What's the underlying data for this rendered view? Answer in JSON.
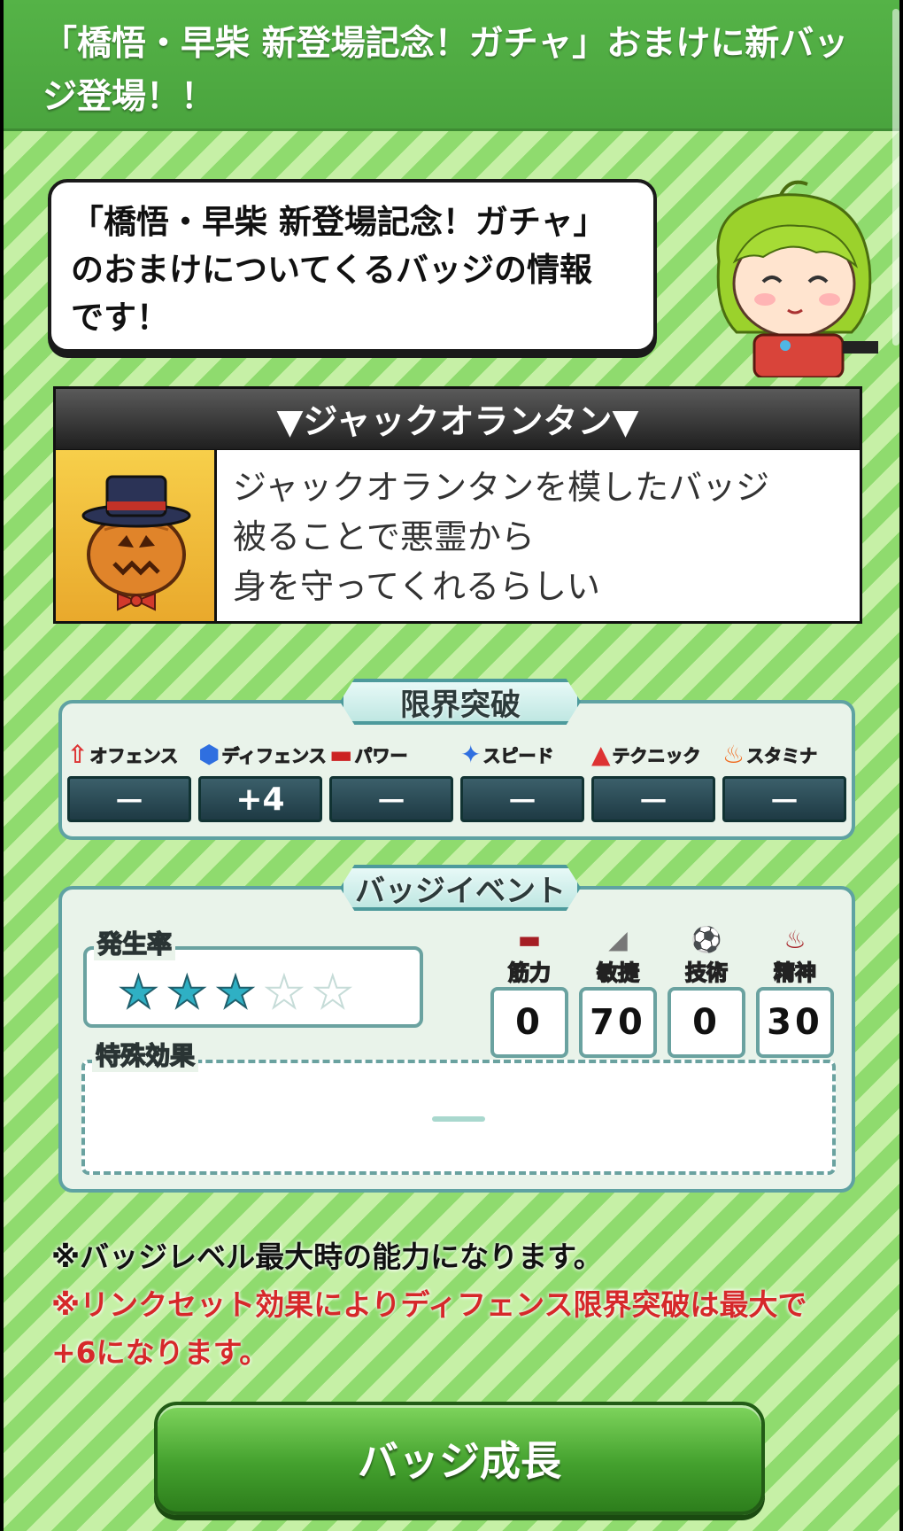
{
  "header": {
    "title": "「橋悟・早柴 新登場記念！ガチャ」おまけに新バッジ登場！！"
  },
  "speech": {
    "lines": [
      "「橋悟・早柴 新登場記念！ガチャ」",
      "のおまけについてくるバッジの情報",
      "です！"
    ]
  },
  "badge": {
    "name": "▼ジャックオランタン▼",
    "description_lines": [
      "ジャックオランタンを模したバッジ",
      "被ることで悪霊から",
      "身を守ってくれるらしい"
    ],
    "icon": "jack-o-lantern-badge-icon"
  },
  "limit_break": {
    "title": "限界突破",
    "stats": [
      {
        "label": "オフェンス",
        "icon": "offense-icon",
        "value": "－"
      },
      {
        "label": "ディフェンス",
        "icon": "defense-icon",
        "value": "+4"
      },
      {
        "label": "パワー",
        "icon": "power-icon",
        "value": "－"
      },
      {
        "label": "スピード",
        "icon": "speed-icon",
        "value": "－"
      },
      {
        "label": "テクニック",
        "icon": "technique-icon",
        "value": "－"
      },
      {
        "label": "スタミナ",
        "icon": "stamina-icon",
        "value": "－"
      }
    ]
  },
  "badge_event": {
    "title": "バッジイベント",
    "rate_label": "発生率",
    "rate_stars": 3,
    "rate_max": 5,
    "params": [
      {
        "label": "筋力",
        "icon": "dumbbell-icon",
        "value": "0"
      },
      {
        "label": "敏捷",
        "icon": "shoe-icon",
        "value": "70"
      },
      {
        "label": "技術",
        "icon": "soccer-ball-icon",
        "value": "0"
      },
      {
        "label": "精神",
        "icon": "flame-icon",
        "value": "30"
      }
    ],
    "special_label": "特殊効果"
  },
  "notes": {
    "note1": "※バッジレベル最大時の能力になります。",
    "note2": "※リンクセット効果によりディフェンス限界突破は最大で+6になります。"
  },
  "button": {
    "label": "バッジ成長"
  },
  "colors": {
    "stripe_light": "#c6f0a6",
    "stripe_dark": "#8fdb6e",
    "header_green": "#4aa43e",
    "note_red": "#d6282a",
    "star_on": "#2fb0c4"
  }
}
